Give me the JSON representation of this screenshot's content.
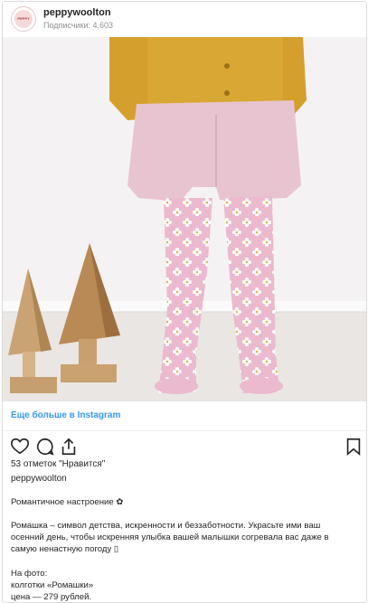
{
  "header": {
    "username": "peppywoolton",
    "followers": "Подписчики: 4,603",
    "avatar_text": "PEPPY"
  },
  "link": {
    "label": "Еще больше в Instagram"
  },
  "post": {
    "likes": "53 отметок \"Нравится\"",
    "author": "peppywoolton",
    "caption_title": "Романтичное настроение ✿",
    "caption_body_1": "Ромашка – символ детства, искренности и беззаботности. Украсьте ими ваш",
    "caption_body_2": "осенний день, чтобы искренняя улыбка вашей малышки согревала вас даже в",
    "caption_body_3": "самую ненастную погоду ▯",
    "photo_label": "На фото:",
    "item": "колготки «Ромашки»",
    "price": "цена — 279 рублей."
  },
  "icons": [
    "heart-icon",
    "comment-icon",
    "share-icon",
    "bookmark-icon"
  ],
  "colors": {
    "link": "#3897f0",
    "sweater": "#d4a22e",
    "shorts": "#e7c3cf",
    "tights": "#eab9cf"
  }
}
